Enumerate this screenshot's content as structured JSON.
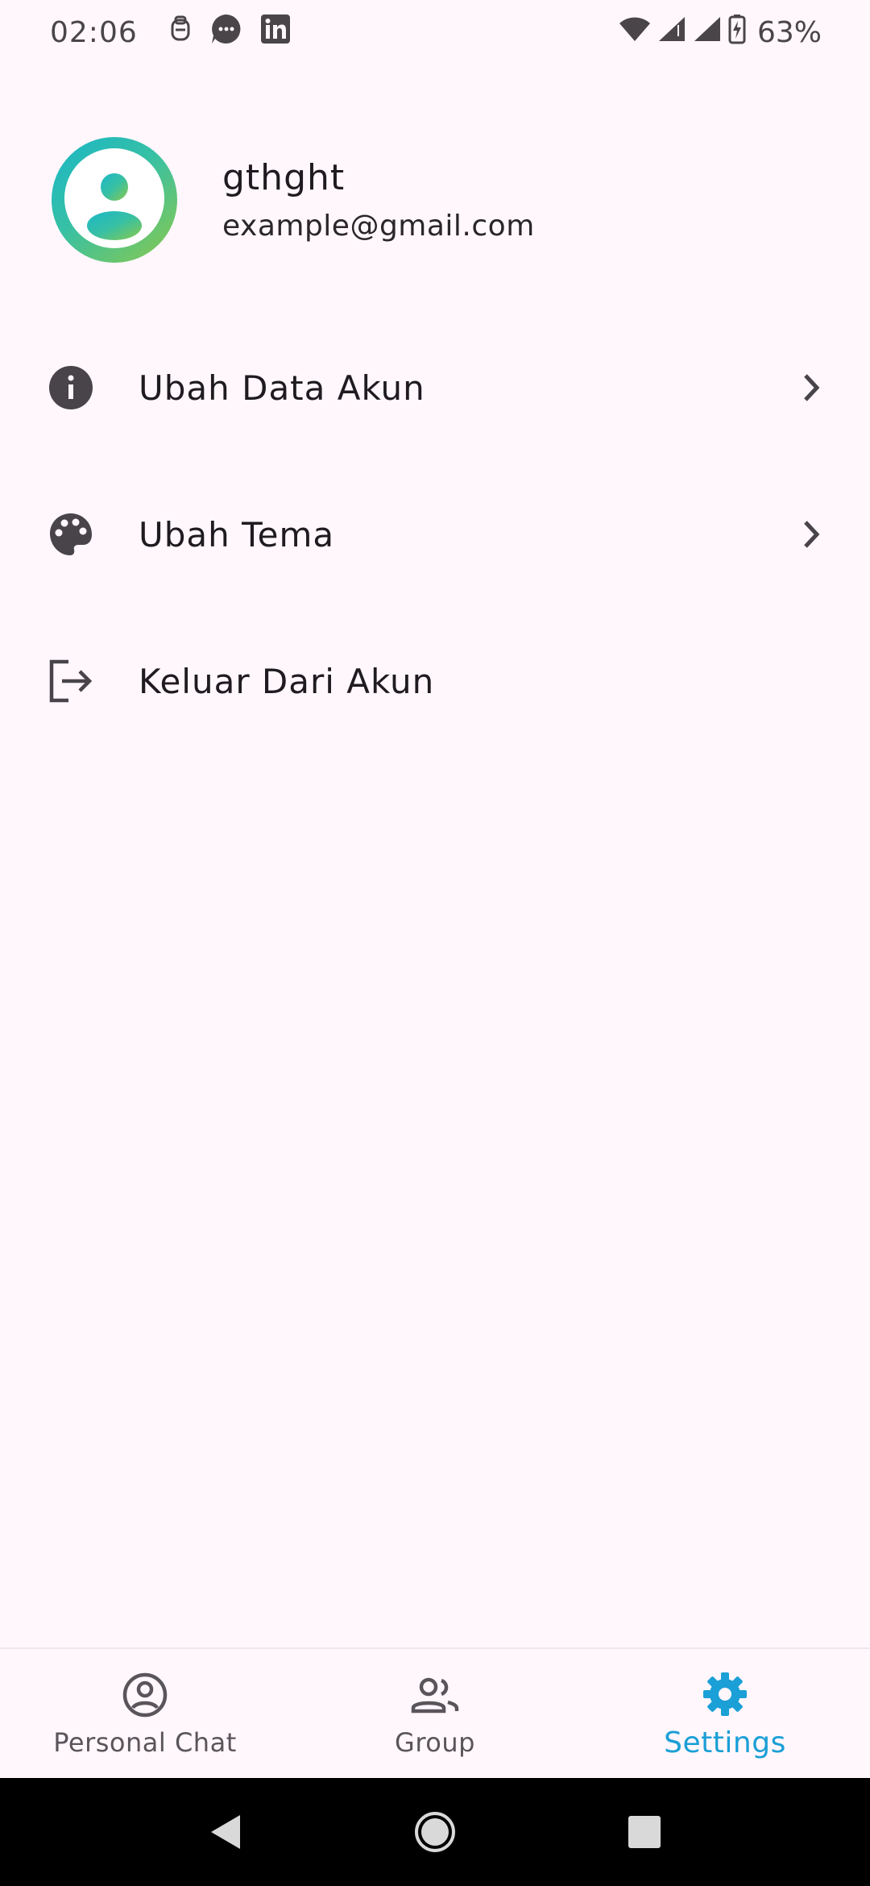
{
  "status_bar": {
    "time": "02:06",
    "battery": "63%",
    "icons": [
      "clipboard-icon",
      "chat-bubble-icon",
      "linkedin-icon",
      "wifi-icon",
      "signal-icon",
      "signal-icon",
      "battery-charging-icon"
    ]
  },
  "profile": {
    "name": "gthght",
    "email": "example@gmail.com",
    "avatar_icon": "account-circle-icon"
  },
  "menu": {
    "items": [
      {
        "label": "Ubah Data Akun",
        "icon": "info-icon",
        "has_chevron": true
      },
      {
        "label": "Ubah Tema",
        "icon": "palette-icon",
        "has_chevron": true
      },
      {
        "label": "Keluar Dari Akun",
        "icon": "logout-icon",
        "has_chevron": false
      }
    ]
  },
  "bottom_nav": {
    "items": [
      {
        "label": "Personal Chat",
        "icon": "account-circle-outline-icon"
      },
      {
        "label": "Group",
        "icon": "people-icon"
      },
      {
        "label": "Settings",
        "icon": "gear-icon",
        "active": true
      }
    ]
  },
  "colors": {
    "background": "#fff7fc",
    "accent": "#1a9fd6",
    "text": "#1f1b20",
    "system_nav": "#000000"
  }
}
